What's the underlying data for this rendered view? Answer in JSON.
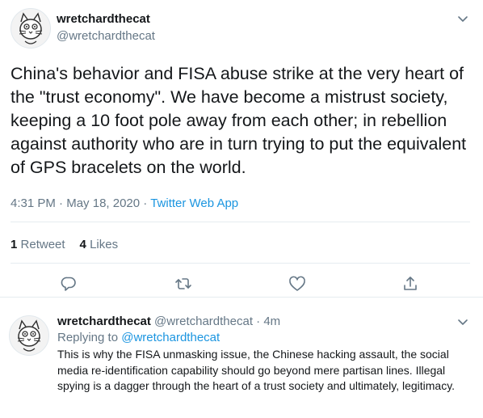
{
  "main_tweet": {
    "display_name": "wretchardthecat",
    "handle": "@wretchardthecat",
    "text": "China's behavior and FISA abuse strike at the very heart of the \"trust economy\". We have become a mistrust society, keeping a 10 foot pole away from each other; in rebellion against authority who are in turn trying to put the equivalent of GPS bracelets on the world.",
    "time": "4:31 PM",
    "date": "May 18, 2020",
    "separator": "·",
    "source": "Twitter Web App",
    "retweets_count": "1",
    "retweets_label": "Retweet",
    "likes_count": "4",
    "likes_label": "Likes",
    "icons": [
      "caret-down-icon",
      "reply-icon",
      "retweet-icon",
      "like-icon",
      "share-icon"
    ]
  },
  "reply_tweet": {
    "display_name": "wretchardthecat",
    "handle": "@wretchardthecat",
    "separator": "·",
    "age": "4m",
    "replying_prefix": "Replying to",
    "replying_to": "@wretchardthecat",
    "text": "This is why the FISA unmasking issue, the Chinese hacking assault, the social media re-identification capability should go beyond mere partisan lines. Illegal spying is a dagger through the heart of a trust society and ultimately, legitimacy."
  },
  "colors": {
    "text": "#14171a",
    "muted": "#657786",
    "link": "#1b95e0",
    "divider": "#e6ecf0"
  }
}
